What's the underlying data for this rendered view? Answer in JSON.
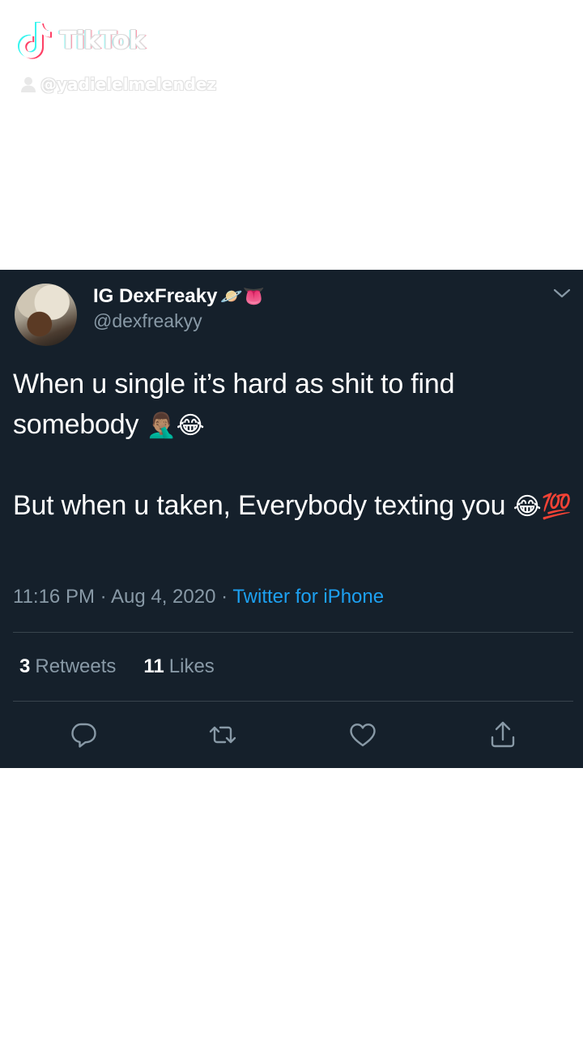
{
  "watermark": {
    "brand": "TikTok",
    "handle": "@yadielelmelendez",
    "icons": [
      "tiktok-note-icon",
      "user-icon"
    ]
  },
  "tweet": {
    "display_name": "IG DexFreaky",
    "name_emojis": "🪐👅",
    "handle": "@dexfreakyy",
    "text_line1": "When u single it’s hard as shit to find somebody ",
    "text_line1_emoji": "🤦🏽‍♂️😂",
    "text_line2": "But when u taken, Everybody texting you ",
    "text_line2_emoji": "😂💯",
    "time": "11:16 PM",
    "separator": "·",
    "date": "Aug 4, 2020",
    "source": "Twitter for iPhone",
    "retweets_count": "3",
    "retweets_label": "Retweets",
    "likes_count": "11",
    "likes_label": "Likes"
  },
  "colors": {
    "card_background": "#15202b",
    "secondary_text": "#8899a6",
    "link": "#1da1f2",
    "divider": "#38444d"
  },
  "action_icons": [
    "reply-icon",
    "retweet-icon",
    "like-icon",
    "share-icon"
  ]
}
